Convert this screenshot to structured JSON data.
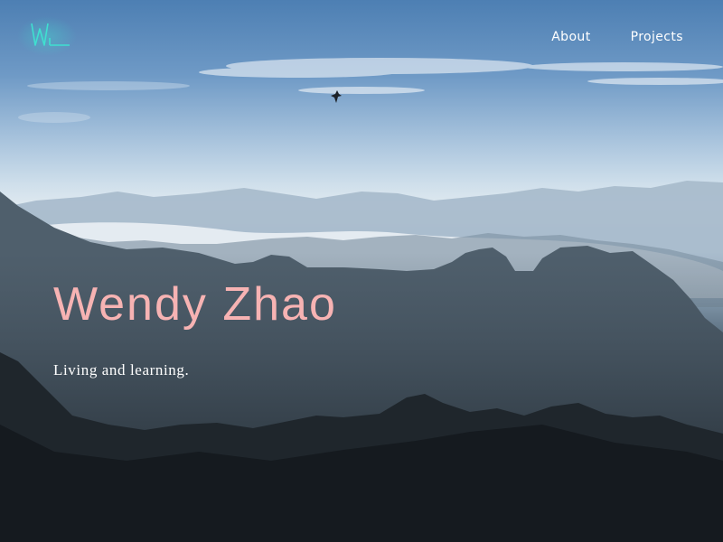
{
  "logo": {
    "text": "WZ",
    "alt": "Wendy Zhao logo",
    "accent_color": "#3fe0d0"
  },
  "nav": {
    "items": [
      {
        "label": "About"
      },
      {
        "label": "Projects"
      }
    ]
  },
  "hero": {
    "title": "Wendy Zhao",
    "tagline": "Living and learning.",
    "title_color": "#f7b3b3",
    "tagline_color": "#ffffff",
    "background": "misty mountain landscape with bird in sky"
  }
}
